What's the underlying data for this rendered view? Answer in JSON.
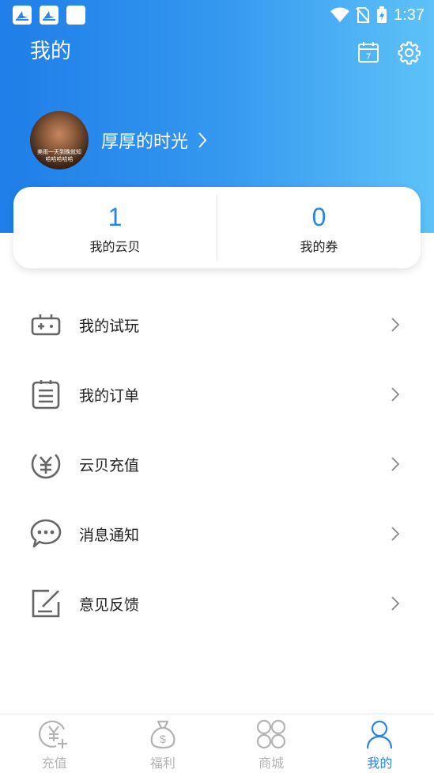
{
  "status_bar": {
    "time": "1:37"
  },
  "header": {
    "title": "我的"
  },
  "profile": {
    "username": "厚厚的时光",
    "avatar_caption": "美雨一天到晚就知\n哈哈哈哈哈"
  },
  "stats": [
    {
      "value": "1",
      "label": "我的云贝"
    },
    {
      "value": "0",
      "label": "我的券"
    }
  ],
  "menu": [
    {
      "label": "我的试玩",
      "icon": "gamepad-icon"
    },
    {
      "label": "我的订单",
      "icon": "order-list-icon"
    },
    {
      "label": "云贝充值",
      "icon": "yuan-coin-icon"
    },
    {
      "label": "消息通知",
      "icon": "message-bubble-icon"
    },
    {
      "label": "意见反馈",
      "icon": "feedback-edit-icon"
    }
  ],
  "tabs": [
    {
      "label": "充值",
      "icon": "recharge-icon",
      "active": false
    },
    {
      "label": "福利",
      "icon": "money-bag-icon",
      "active": false
    },
    {
      "label": "商城",
      "icon": "grid-icon",
      "active": false
    },
    {
      "label": "我的",
      "icon": "person-icon",
      "active": true
    }
  ],
  "calendar_day": "7",
  "colors": {
    "accent": "#2a84e6",
    "gradient_start": "#1f7ee8",
    "gradient_end": "#5ec2f8",
    "inactive_tab": "#b3b3b3"
  }
}
